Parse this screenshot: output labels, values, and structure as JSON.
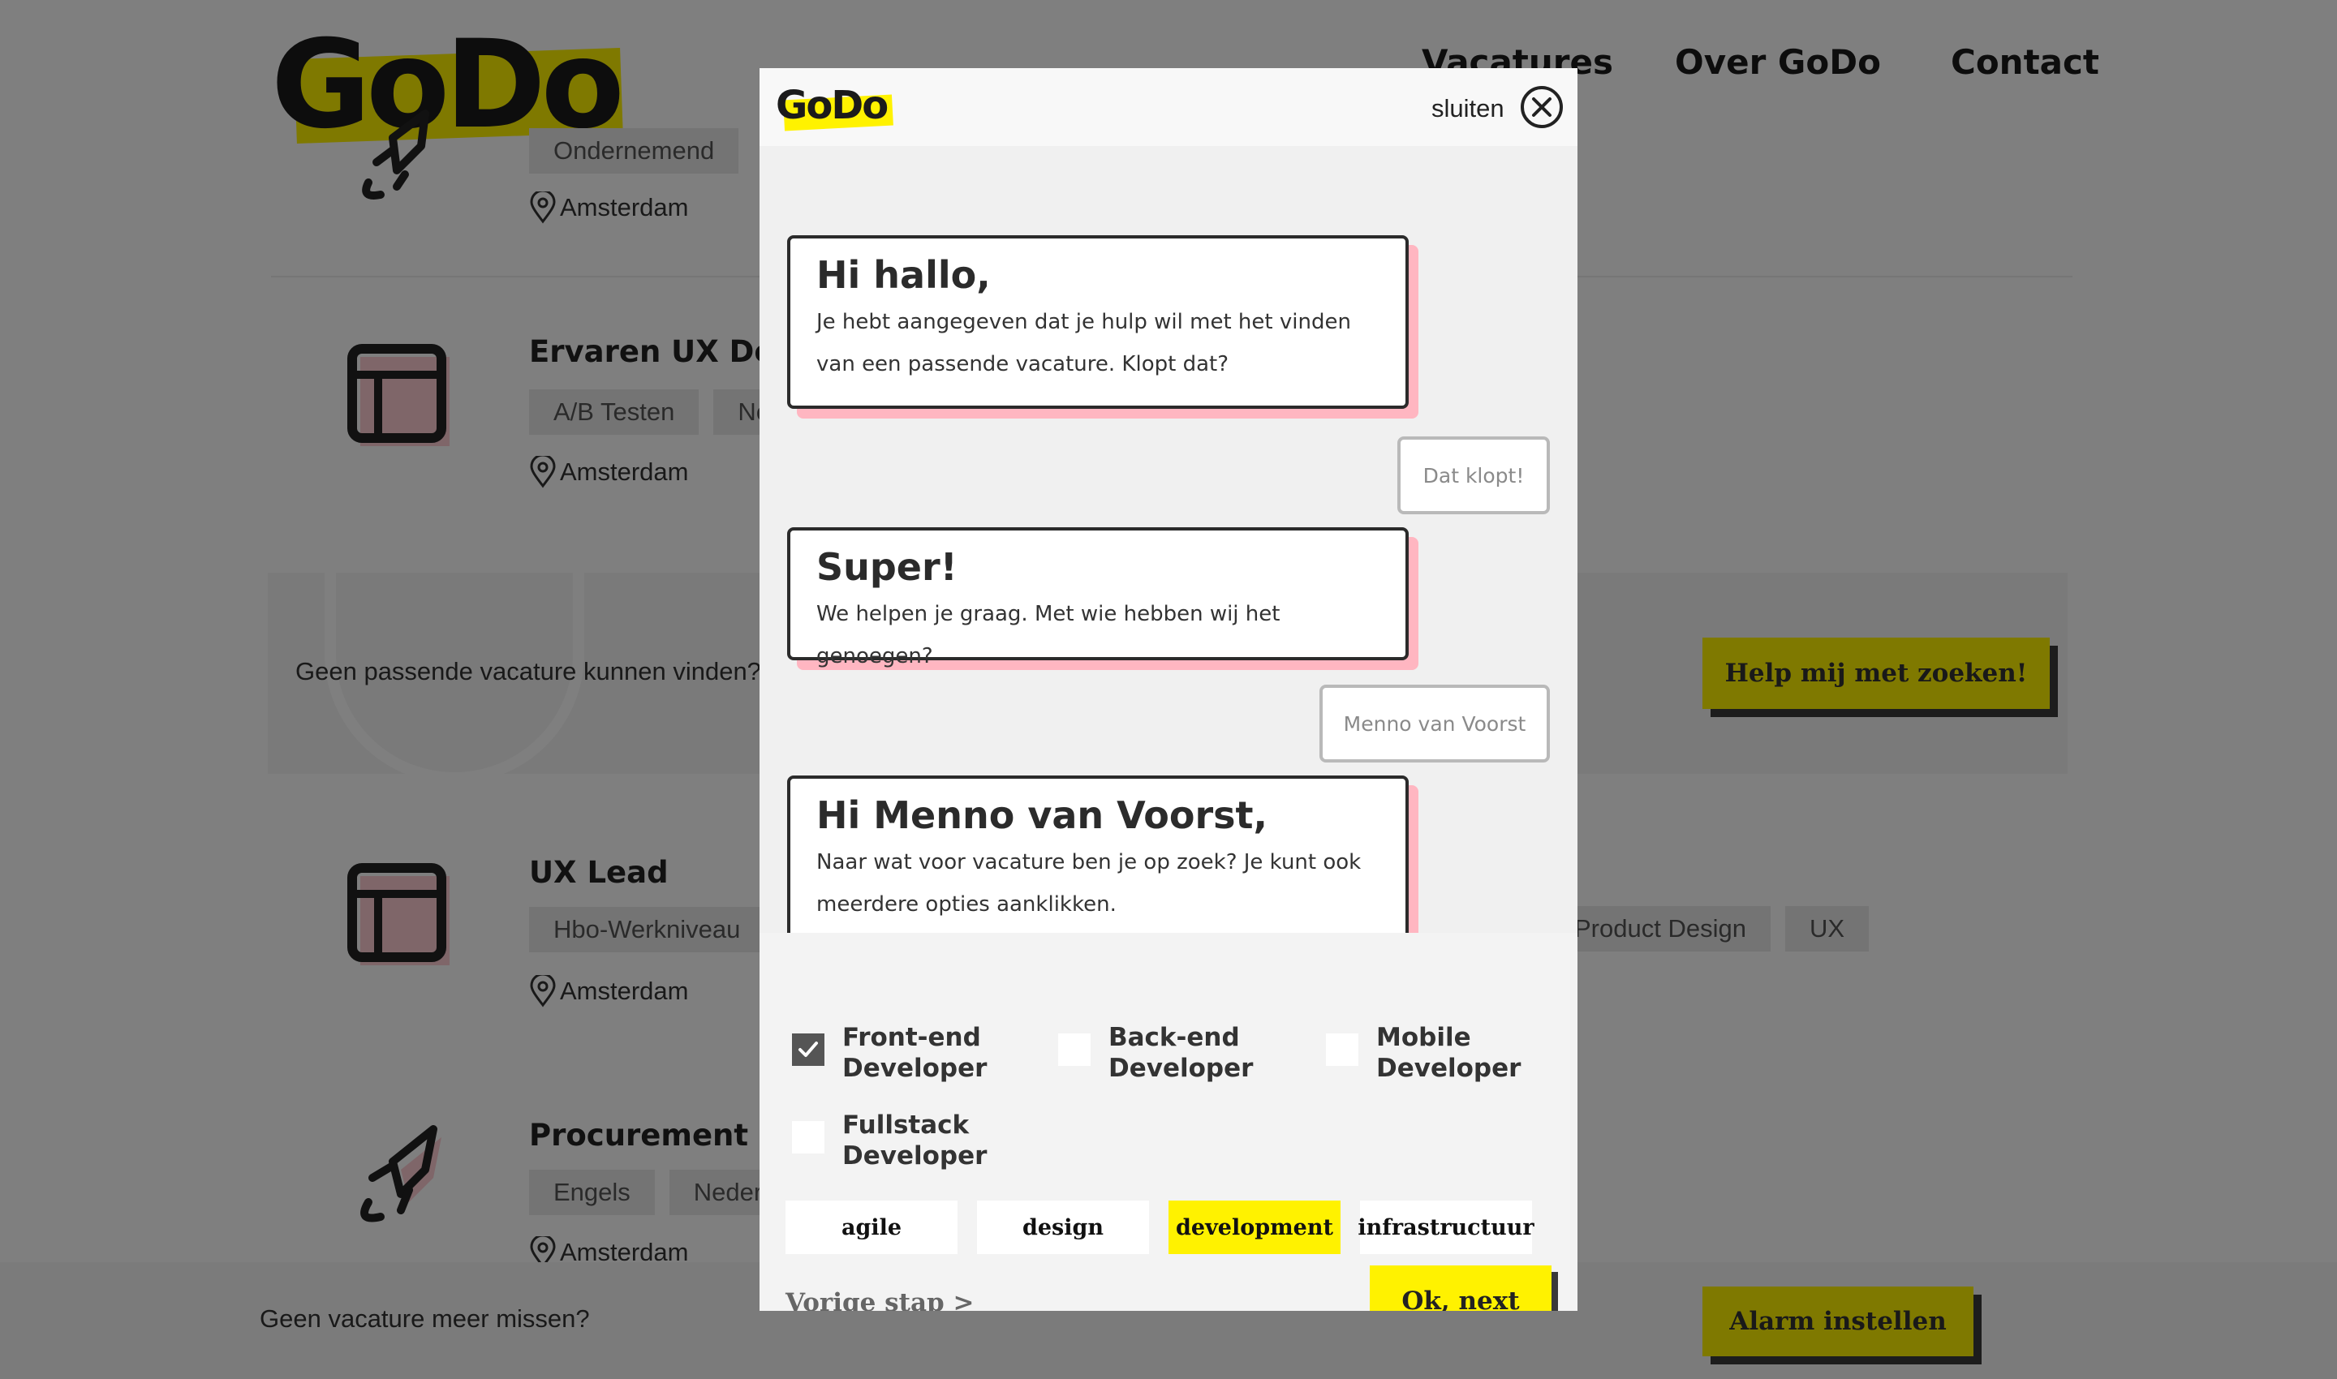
{
  "site": {
    "logo_text": "GoDo",
    "nav": {
      "vacatures": "Vacatures",
      "over": "Over GoDo",
      "contact": "Contact"
    }
  },
  "jobs": [
    {
      "title": "",
      "icon": "rocket-icon",
      "tags": [
        "Ondernemend"
      ],
      "location": "Amsterdam"
    },
    {
      "title": "Ervaren UX Designer",
      "icon": "layout-icon",
      "tags": [
        "A/B Testen",
        "Nederlands"
      ],
      "location": "Amsterdam"
    },
    {
      "title": "UX Lead",
      "icon": "layout-icon",
      "tags": [
        "Hbo-Werkniveau"
      ],
      "tags_right": [
        "Product Design",
        "UX"
      ],
      "location": "Amsterdam"
    },
    {
      "title": "Procurement Manager",
      "icon": "rocket-icon",
      "tags": [
        "Engels",
        "Nederlands"
      ],
      "location": "Amsterdam"
    }
  ],
  "search_banner": {
    "text": "Geen passende vacature kunnen vinden?",
    "button": "Help mij met zoeken!"
  },
  "alarm_bar": {
    "text": "Geen vacature meer missen?",
    "button": "Alarm instellen"
  },
  "modal": {
    "logo_text": "GoDo",
    "close_label": "sluiten",
    "messages": [
      {
        "type": "bot",
        "title": "Hi hallo,",
        "text": "Je hebt aangegeven dat je hulp wil met het vinden van een passende vacature. Klopt dat?"
      },
      {
        "type": "user",
        "text": "Dat klopt!"
      },
      {
        "type": "bot",
        "title": "Super!",
        "text": "We helpen je graag. Met wie hebben wij het genoegen?"
      },
      {
        "type": "user",
        "text": "Menno van Voorst"
      },
      {
        "type": "bot",
        "title": "Hi Menno van Voorst,",
        "text": "Naar wat voor vacature ben je op zoek? Je kunt ook meerdere opties aanklikken."
      }
    ],
    "options": [
      {
        "label": "Front-end Developer",
        "checked": true
      },
      {
        "label": "Back-end Developer",
        "checked": false
      },
      {
        "label": "Mobile Developer",
        "checked": false
      },
      {
        "label": "Fullstack Developer",
        "checked": false
      }
    ],
    "chips": [
      {
        "label": "agile",
        "active": false
      },
      {
        "label": "design",
        "active": false
      },
      {
        "label": "development",
        "active": true
      },
      {
        "label": "infrastructuur",
        "active": false
      }
    ],
    "prev_step": "Vorige stap >",
    "next_button": "Ok, next"
  },
  "colors": {
    "accent": "#fff200",
    "shadow_pink": "#ffb6c1",
    "dark": "#2b2b2b"
  }
}
